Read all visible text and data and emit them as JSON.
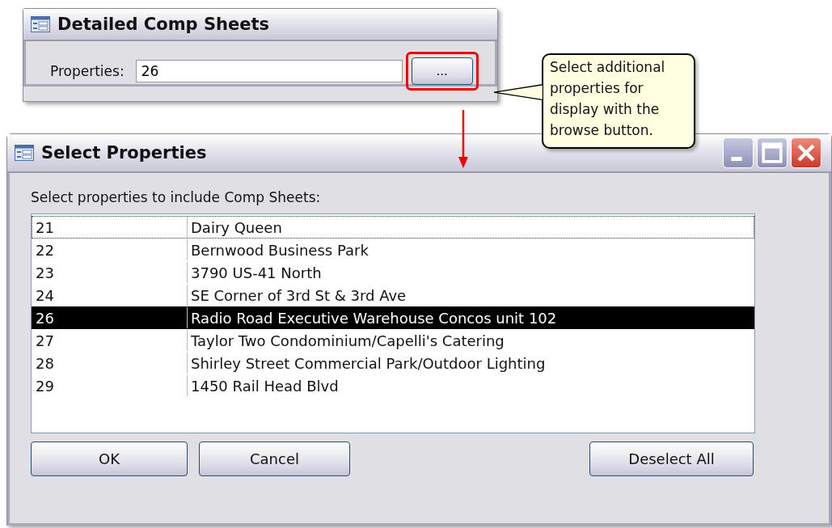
{
  "form_window": {
    "title": "Detailed Comp Sheets",
    "field_label": "Properties:",
    "field_value": "26",
    "browse_button": "...",
    "highlighted": true
  },
  "callout": {
    "text": "Select additional properties for display with the browse button."
  },
  "dialog": {
    "title": "Select Properties",
    "prompt": "Select properties to include Comp Sheets:",
    "rows": [
      {
        "id": "21",
        "name": "Dairy Queen",
        "selected": false,
        "focused": true
      },
      {
        "id": "22",
        "name": "Bernwood Business Park",
        "selected": false,
        "focused": false
      },
      {
        "id": "23",
        "name": "3790 US-41 North",
        "selected": false,
        "focused": false
      },
      {
        "id": "24",
        "name": "SE Corner of 3rd St & 3rd Ave",
        "selected": false,
        "focused": false
      },
      {
        "id": "26",
        "name": "Radio Road Executive Warehouse Concos unit 102",
        "selected": true,
        "focused": false
      },
      {
        "id": "27",
        "name": "Taylor Two Condominium/Capelli's Catering",
        "selected": false,
        "focused": false
      },
      {
        "id": "28",
        "name": "Shirley Street Commercial Park/Outdoor Lighting",
        "selected": false,
        "focused": false
      },
      {
        "id": "29",
        "name": "1450 Rail Head Blvd",
        "selected": false,
        "focused": false
      }
    ],
    "buttons": [
      {
        "label": "OK",
        "kind": "left"
      },
      {
        "label": "Cancel",
        "kind": "left"
      },
      {
        "label": "Deselect All",
        "kind": "right"
      }
    ]
  }
}
